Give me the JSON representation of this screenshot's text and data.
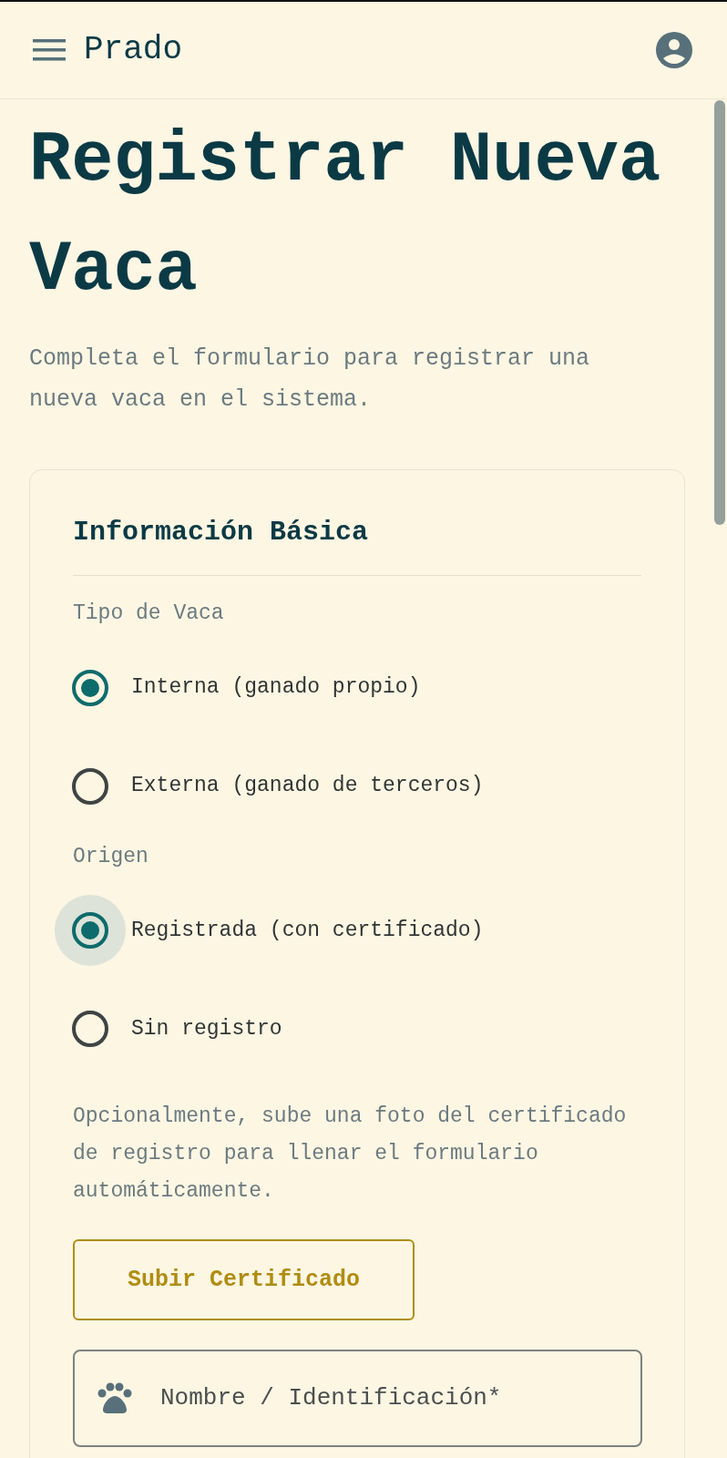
{
  "app_bar": {
    "title": "Prado"
  },
  "page": {
    "title": "Registrar Nueva Vaca",
    "subtitle": "Completa el formulario para registrar una nueva vaca en el sistema."
  },
  "card": {
    "heading": "Información Básica",
    "groups": [
      {
        "label": "Tipo de Vaca",
        "options": [
          {
            "label": "Interna (ganado propio)",
            "selected": true,
            "focused": false
          },
          {
            "label": "Externa (ganado de terceros)",
            "selected": false,
            "focused": false
          }
        ]
      },
      {
        "label": "Origen",
        "options": [
          {
            "label": "Registrada (con certificado)",
            "selected": true,
            "focused": true
          },
          {
            "label": "Sin registro",
            "selected": false,
            "focused": false
          }
        ]
      }
    ],
    "hint": "Opcionalmente, sube una foto del certificado de registro para llenar el formulario automáticamente.",
    "upload_button": "Subir Certificado",
    "name_field": {
      "placeholder": "Nombre / Identificación*"
    }
  }
}
